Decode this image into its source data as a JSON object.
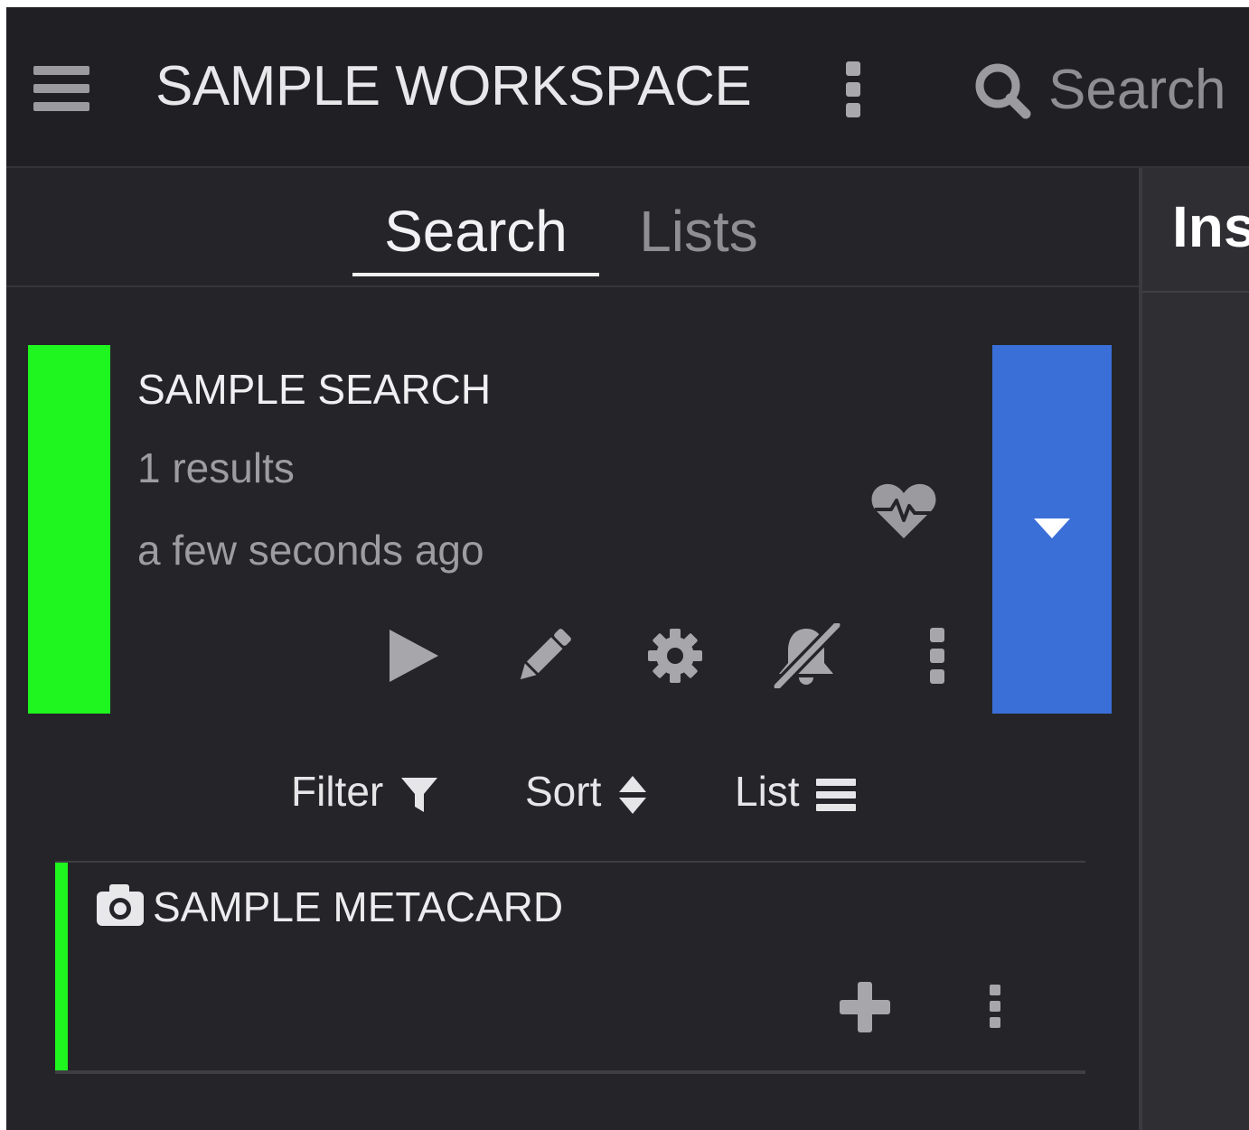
{
  "header": {
    "title": "SAMPLE WORKSPACE",
    "search_placeholder": "Search"
  },
  "tabs": [
    {
      "label": "Search",
      "active": true
    },
    {
      "label": "Lists",
      "active": false
    }
  ],
  "search_card": {
    "title": "SAMPLE SEARCH",
    "results": "1 results",
    "time": "a few seconds ago",
    "status_color": "#1ff51f",
    "expand_color": "#3a6fd8",
    "actions": [
      "play-icon",
      "pencil-icon",
      "gear-icon",
      "bell-slash-icon",
      "more-vertical-icon"
    ]
  },
  "toolbar": {
    "filter_label": "Filter",
    "sort_label": "Sort",
    "list_label": "List"
  },
  "results": [
    {
      "title": "SAMPLE METACARD",
      "icon": "camera-icon"
    }
  ],
  "right_panel": {
    "title": "Ins"
  }
}
